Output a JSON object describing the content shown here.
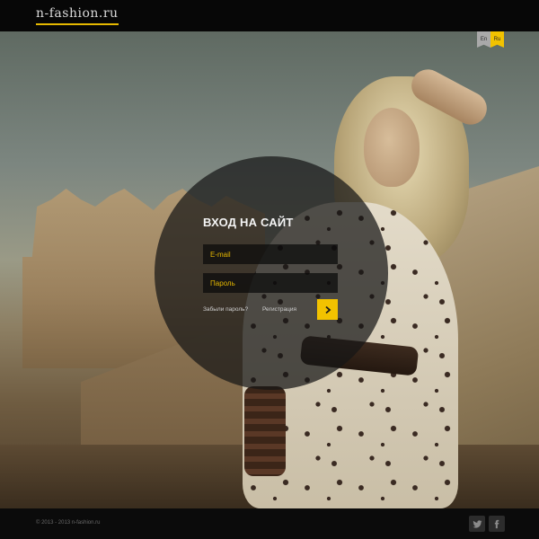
{
  "header": {
    "logo": "n-fashion.ru"
  },
  "languages": [
    {
      "label": "En",
      "active": false
    },
    {
      "label": "Ru",
      "active": true
    }
  ],
  "login": {
    "title": "ВХОД НА САЙТ",
    "email_placeholder": "E-mail",
    "password_placeholder": "Пароль",
    "forgot_label": "Забыли пароль?",
    "register_label": "Регистрация",
    "submit_icon": "chevron-right-icon"
  },
  "footer": {
    "copyright": "© 2013 - 2013 n-fashion.ru",
    "social": [
      {
        "icon": "twitter-icon"
      },
      {
        "icon": "facebook-icon"
      }
    ]
  },
  "colors": {
    "accent": "#f2c200",
    "header_bg": "#070707",
    "login_bg": "#161616"
  }
}
